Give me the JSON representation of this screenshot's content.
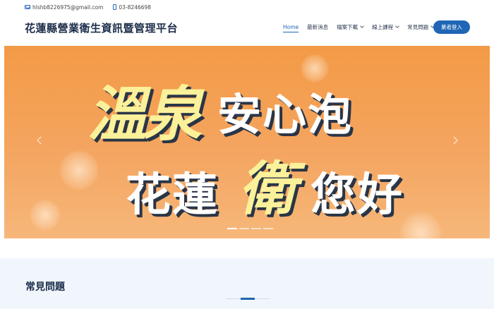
{
  "topbar": {
    "email": "hlshb8226975@gmail.com",
    "phone": "03-8246698"
  },
  "header": {
    "title": "花蓮縣營業衛生資訊暨管理平台",
    "login_label": "業者登入"
  },
  "nav": {
    "items": [
      {
        "label": "Home",
        "active": true,
        "dropdown": false
      },
      {
        "label": "最新消息",
        "active": false,
        "dropdown": false
      },
      {
        "label": "檔案下載",
        "active": false,
        "dropdown": true
      },
      {
        "label": "線上課程",
        "active": false,
        "dropdown": true
      },
      {
        "label": "常見問題",
        "active": false,
        "dropdown": true
      }
    ]
  },
  "banner": {
    "line1_accent": "溫泉",
    "line1_rest": "安心泡",
    "line2_start": "花蓮",
    "line2_accent": "衛",
    "line2_end": "您好",
    "slide_count": 4,
    "active_slide": 0
  },
  "faq": {
    "title": "常見問題"
  },
  "colors": {
    "accent": "#1f66b5",
    "banner_orange": "#f39a46",
    "heading": "#1c2d4a"
  }
}
